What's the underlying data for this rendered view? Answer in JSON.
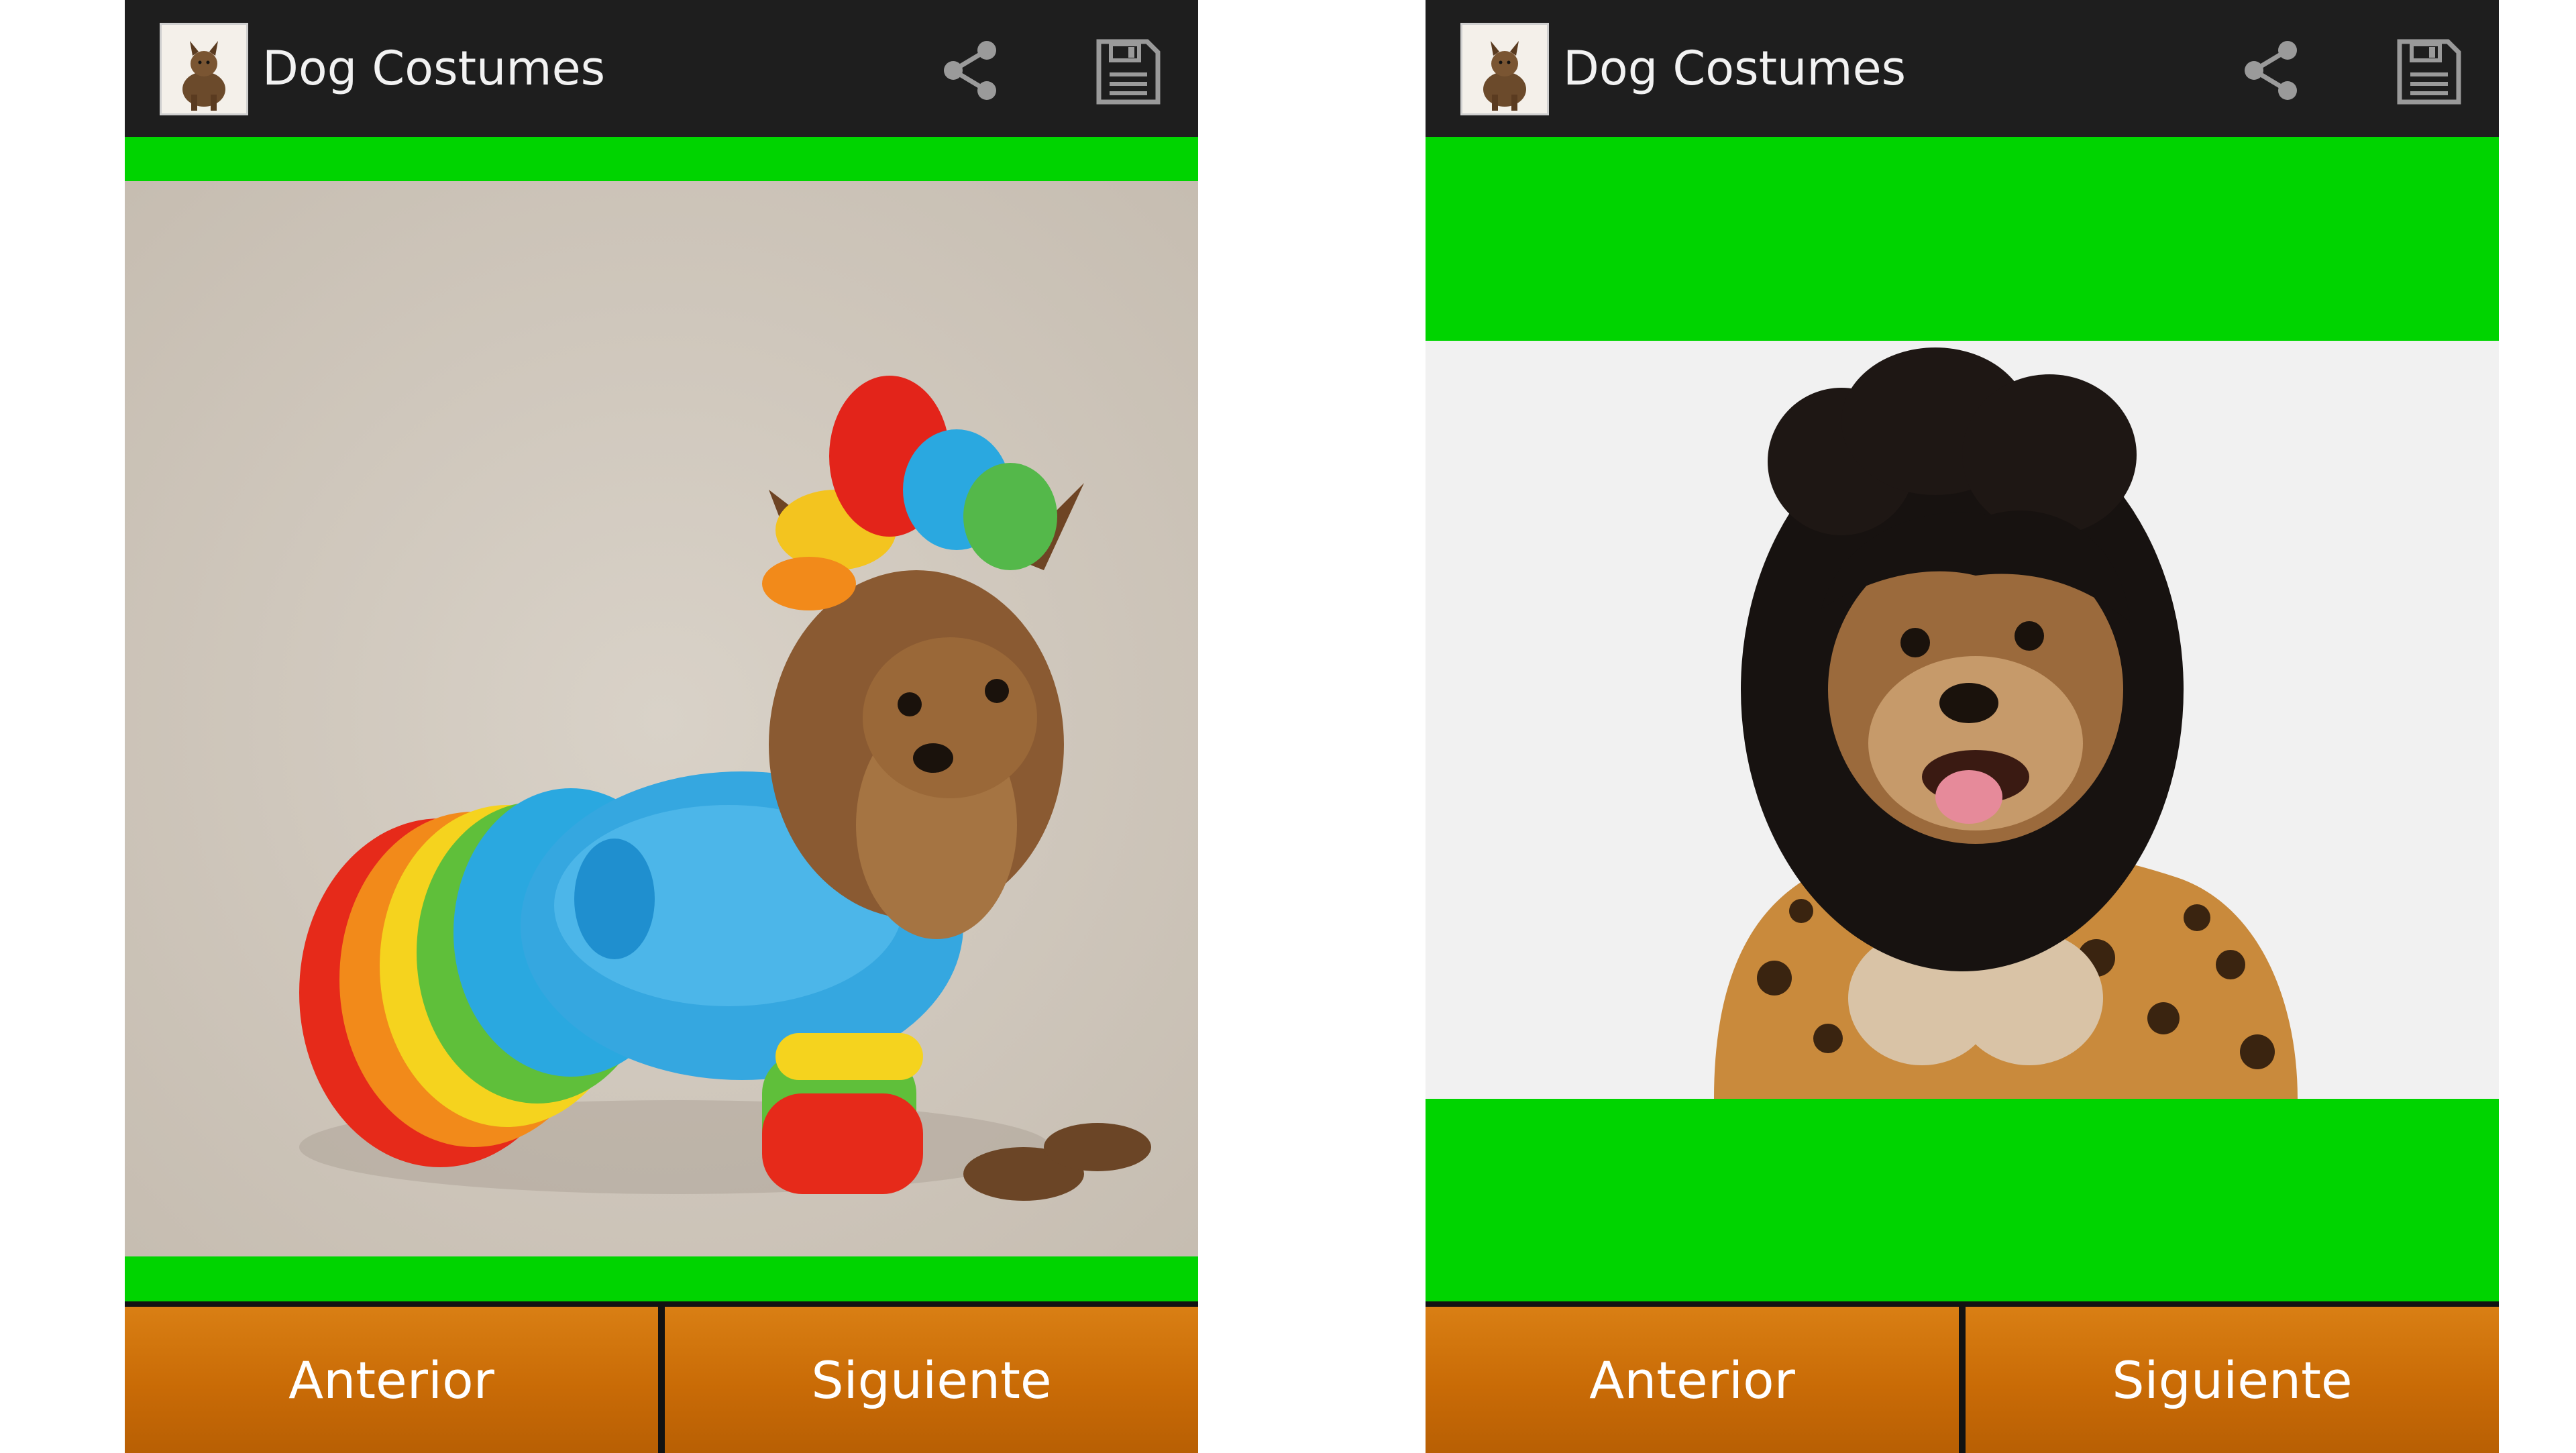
{
  "screens": [
    {
      "app_title": "Dog Costumes",
      "actions": {
        "share_icon": "share-icon",
        "save_icon": "floppy-disk-icon"
      },
      "photo_subject": "Yorkshire terrier in ruffled rainbow dress with feather headpiece",
      "buttons": {
        "previous": "Anterior",
        "next": "Siguiente"
      }
    },
    {
      "app_title": "Dog Costumes",
      "actions": {
        "share_icon": "share-icon",
        "save_icon": "floppy-disk-icon"
      },
      "photo_subject": "small dog wearing black wig and leopard-print outfit",
      "buttons": {
        "previous": "Anterior",
        "next": "Siguiente"
      }
    }
  ],
  "colors": {
    "action_bar": "#1e1e1e",
    "accent_green": "#00d400",
    "button_orange": "#c96b06",
    "button_text": "#ffffff"
  }
}
